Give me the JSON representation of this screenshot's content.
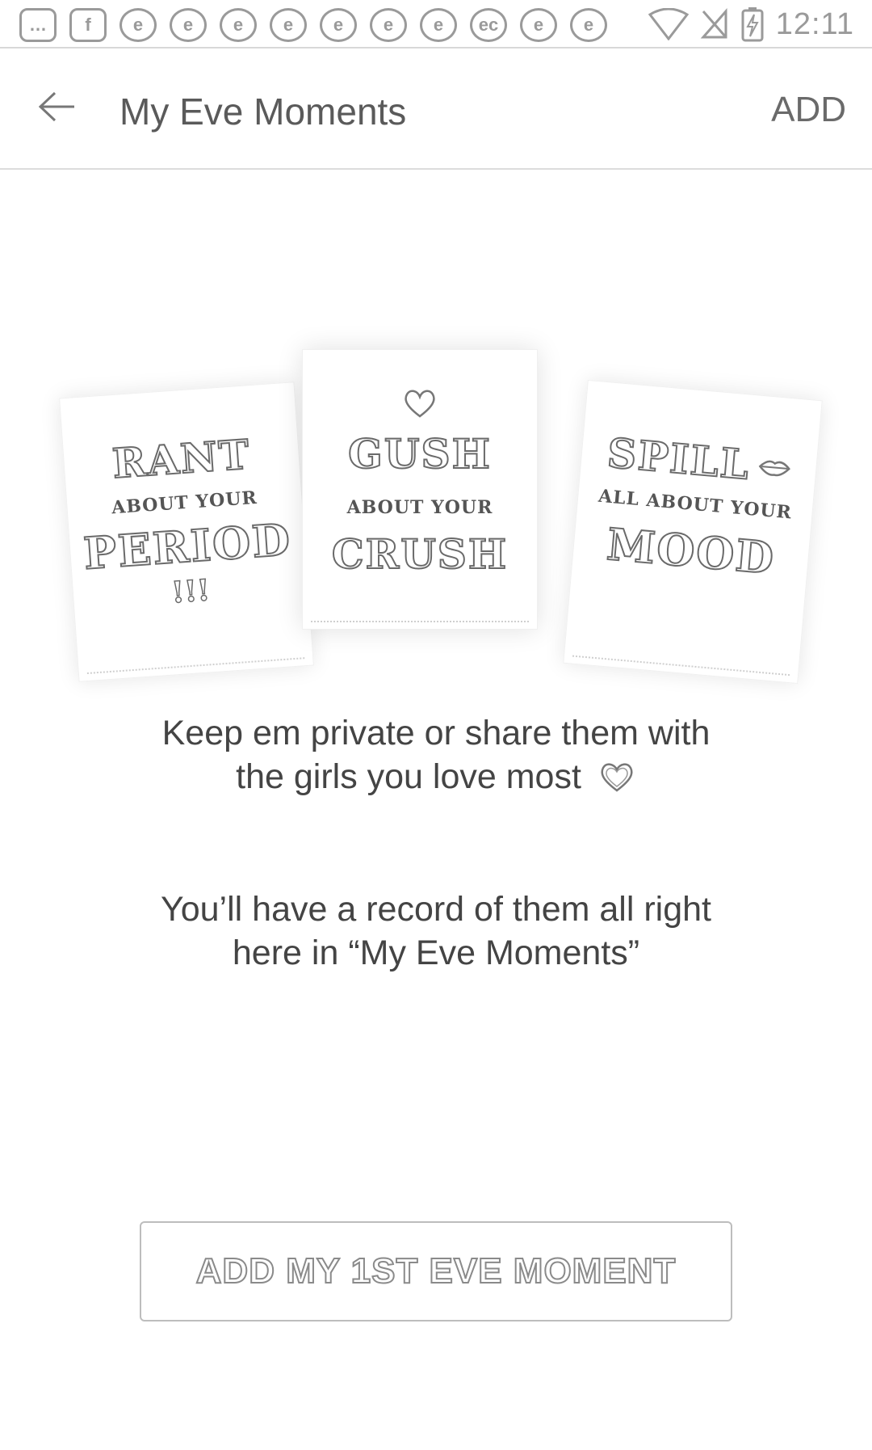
{
  "status_bar": {
    "notification_icons": [
      "more-icon",
      "facebook-icon",
      "app-icon",
      "app-icon",
      "app-icon",
      "app-icon",
      "app-icon",
      "app-icon",
      "app-icon",
      "app-icon",
      "app-icon",
      "app-icon"
    ],
    "notification_glyphs": [
      "…",
      "f",
      "e",
      "e",
      "e",
      "e",
      "e",
      "e",
      "e",
      "ec",
      "e",
      "e"
    ],
    "time": "12:11"
  },
  "app_bar": {
    "title": "My Eve Moments",
    "action_label": "ADD"
  },
  "cards": {
    "left": {
      "line1": "RANT",
      "line2": "ABOUT YOUR",
      "line3": "PERIOD",
      "mark": "!!!"
    },
    "middle": {
      "line1": "GUSH",
      "line2": "ABOUT YOUR",
      "line3": "CRUSH"
    },
    "right": {
      "line1": "SPILL",
      "line2": "ALL ABOUT YOUR",
      "line3": "MOOD"
    }
  },
  "body": {
    "paragraph1_line1": "Keep em private or share them with",
    "paragraph1_line2": "the girls you love most",
    "paragraph2_line1": "You’ll have a record of them all right",
    "paragraph2_line2": "here in “My Eve Moments”"
  },
  "cta": {
    "label": "ADD MY 1ST EVE MOMENT"
  },
  "colors": {
    "text": "#444444",
    "border": "#bdbdbd",
    "icon": "#9a9a9a"
  }
}
